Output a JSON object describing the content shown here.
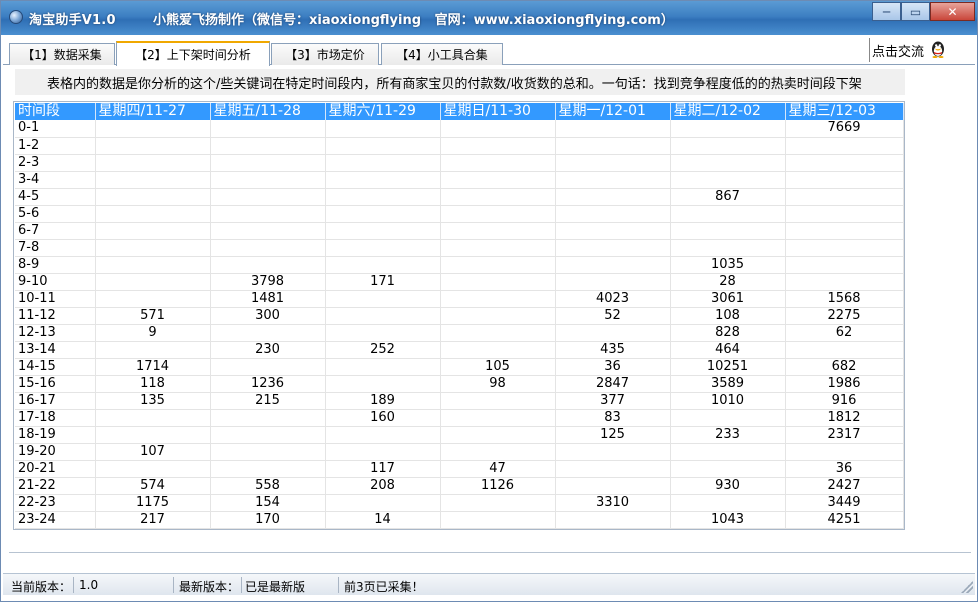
{
  "window": {
    "app_title": "淘宝助手V1.0",
    "maker_info": "小熊爱飞扬制作（微信号：xiaoxiongflying   官网：www.xiaoxiongflying.com）",
    "min_label": "─",
    "max_label": "▭",
    "close_label": "✕"
  },
  "tabs": [
    {
      "label": "【1】数据采集"
    },
    {
      "label": "【2】上下架时间分析"
    },
    {
      "label": "【3】市场定价"
    },
    {
      "label": "【4】小工具合集"
    }
  ],
  "qq": {
    "label": "点击交流",
    "icon": "qq-penguin-icon"
  },
  "notice": "表格内的数据是你分析的这个/些关键词在特定时间段内，所有商家宝贝的付款数/收货数的总和。一句话：找到竞争程度低的的热卖时间段下架",
  "table": {
    "headers": [
      "时间段",
      "星期四/11-27",
      "星期五/11-28",
      "星期六/11-29",
      "星期日/11-30",
      "星期一/12-01",
      "星期二/12-02",
      "星期三/12-03"
    ],
    "rows": [
      [
        "0-1",
        "",
        "",
        "",
        "",
        "",
        "",
        "7669"
      ],
      [
        "1-2",
        "",
        "",
        "",
        "",
        "",
        "",
        ""
      ],
      [
        "2-3",
        "",
        "",
        "",
        "",
        "",
        "",
        ""
      ],
      [
        "3-4",
        "",
        "",
        "",
        "",
        "",
        "",
        ""
      ],
      [
        "4-5",
        "",
        "",
        "",
        "",
        "",
        "867",
        ""
      ],
      [
        "5-6",
        "",
        "",
        "",
        "",
        "",
        "",
        ""
      ],
      [
        "6-7",
        "",
        "",
        "",
        "",
        "",
        "",
        ""
      ],
      [
        "7-8",
        "",
        "",
        "",
        "",
        "",
        "",
        ""
      ],
      [
        "8-9",
        "",
        "",
        "",
        "",
        "",
        "1035",
        ""
      ],
      [
        "9-10",
        "",
        "3798",
        "171",
        "",
        "",
        "28",
        ""
      ],
      [
        "10-11",
        "",
        "1481",
        "",
        "",
        "4023",
        "3061",
        "1568"
      ],
      [
        "11-12",
        "571",
        "300",
        "",
        "",
        "52",
        "108",
        "2275"
      ],
      [
        "12-13",
        "9",
        "",
        "",
        "",
        "",
        "828",
        "62"
      ],
      [
        "13-14",
        "",
        "230",
        "252",
        "",
        "435",
        "464",
        ""
      ],
      [
        "14-15",
        "1714",
        "",
        "",
        "105",
        "36",
        "10251",
        "682"
      ],
      [
        "15-16",
        "118",
        "1236",
        "",
        "98",
        "2847",
        "3589",
        "1986"
      ],
      [
        "16-17",
        "135",
        "215",
        "189",
        "",
        "377",
        "1010",
        "916"
      ],
      [
        "17-18",
        "",
        "",
        "160",
        "",
        "83",
        "",
        "1812"
      ],
      [
        "18-19",
        "",
        "",
        "",
        "",
        "125",
        "233",
        "2317"
      ],
      [
        "19-20",
        "107",
        "",
        "",
        "",
        "",
        "",
        ""
      ],
      [
        "20-21",
        "",
        "",
        "117",
        "47",
        "",
        "",
        "36"
      ],
      [
        "21-22",
        "574",
        "558",
        "208",
        "1126",
        "",
        "930",
        "2427"
      ],
      [
        "22-23",
        "1175",
        "154",
        "",
        "",
        "3310",
        "",
        "3449"
      ],
      [
        "23-24",
        "217",
        "170",
        "14",
        "",
        "",
        "1043",
        "4251"
      ]
    ]
  },
  "status": {
    "current_version_label": "当前版本：",
    "current_version": "1.0",
    "latest_version_label": "最新版本：",
    "latest_version": "已是最新版",
    "message": "前3页已采集！"
  },
  "colors": {
    "header_bg": "#3399ff",
    "titlebar": "#3d7fc2",
    "active_tab_accent": "#f0a800"
  }
}
